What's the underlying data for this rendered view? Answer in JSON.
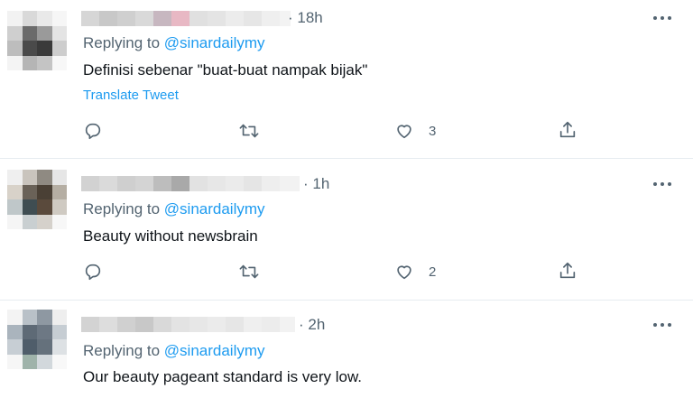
{
  "colors": {
    "link": "#1d9bf0",
    "muted": "#536471",
    "text": "#0f1419",
    "divider": "#e6ecf0"
  },
  "icons": {
    "more": "more-horizontal-icon",
    "reply": "reply-icon",
    "retweet": "retweet-icon",
    "like": "heart-icon",
    "share": "share-icon"
  },
  "tweets": [
    {
      "time": "· 18h",
      "replying_prefix": "Replying to ",
      "replying_handle": "@sinardailymy",
      "text": "Definisi sebenar \"buat-buat nampak bijak\"",
      "translate": "Translate Tweet",
      "like_count": "3"
    },
    {
      "time": "· 1h",
      "replying_prefix": "Replying to ",
      "replying_handle": "@sinardailymy",
      "text": "Beauty without newsbrain",
      "like_count": "2"
    },
    {
      "time": "· 2h",
      "replying_prefix": "Replying to ",
      "replying_handle": "@sinardailymy",
      "text": "Our beauty pageant standard is very low."
    }
  ]
}
